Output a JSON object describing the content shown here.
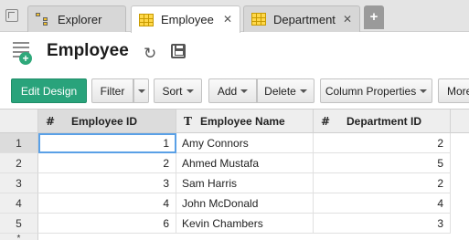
{
  "tabs": [
    {
      "label": "Explorer",
      "icon": "tree-icon",
      "active": false
    },
    {
      "label": "Employee",
      "icon": "table-icon",
      "active": true,
      "close": "✕"
    },
    {
      "label": "Department",
      "icon": "table-icon",
      "active": false,
      "close": "✕"
    }
  ],
  "tab_add_label": "+",
  "page": {
    "title": "Employee"
  },
  "toolbar": {
    "edit_design": "Edit Design",
    "filter": "Filter",
    "sort": "Sort",
    "add": "Add",
    "delete": "Delete",
    "column_properties": "Column Properties",
    "more": "More"
  },
  "grid": {
    "columns": [
      {
        "symbol": "#",
        "label": "Employee ID"
      },
      {
        "symbol": "T",
        "label": "Employee Name"
      },
      {
        "symbol": "#",
        "label": "Department ID"
      }
    ],
    "rows": [
      {
        "num": "1",
        "id": "1",
        "name": "Amy Connors",
        "dept": "2"
      },
      {
        "num": "2",
        "id": "2",
        "name": "Ahmed Mustafa",
        "dept": "5"
      },
      {
        "num": "3",
        "id": "3",
        "name": "Sam Harris",
        "dept": "2"
      },
      {
        "num": "4",
        "id": "4",
        "name": "John McDonald",
        "dept": "4"
      },
      {
        "num": "5",
        "id": "6",
        "name": "Kevin Chambers",
        "dept": "3"
      }
    ],
    "new_row_marker": "*"
  },
  "colors": {
    "accent": "#29a37b",
    "selection": "#5aa0e6"
  }
}
